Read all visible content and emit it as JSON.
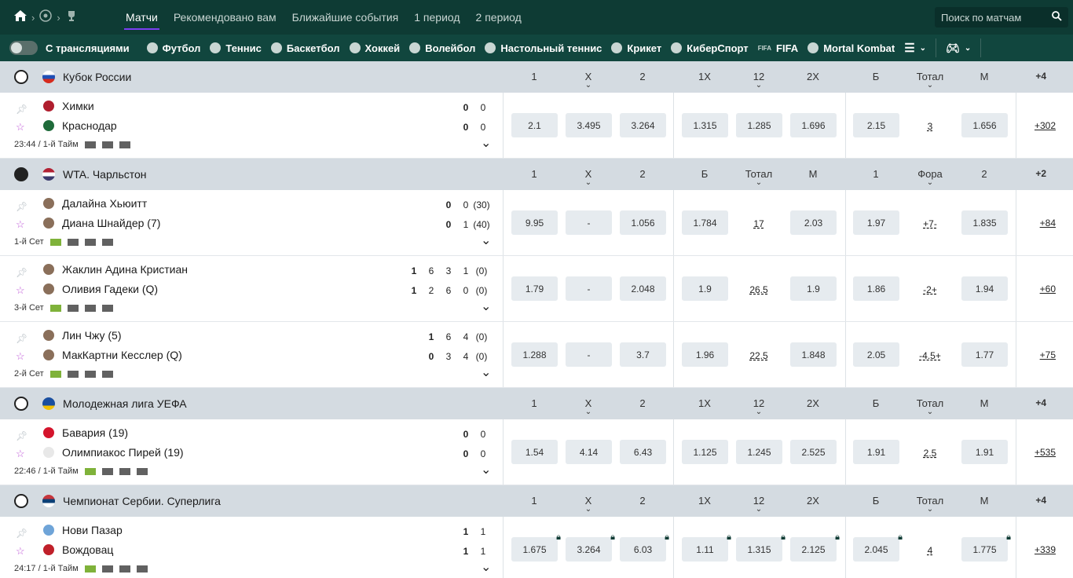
{
  "topbar": {
    "tabs": [
      "Матчи",
      "Рекомендовано вам",
      "Ближайшие события",
      "1 период",
      "2 период"
    ],
    "search_placeholder": "Поиск по матчам"
  },
  "sportbar": {
    "stream_label": "С трансляциями",
    "sports": [
      "Футбол",
      "Теннис",
      "Баскетбол",
      "Хоккей",
      "Волейбол",
      "Настольный теннис",
      "Крикет",
      "КиберСпорт",
      "FIFA",
      "Mortal Kombat"
    ]
  },
  "sections": [
    {
      "league": "Кубок России",
      "headers": [
        "1",
        "X",
        "2",
        "1X",
        "12",
        "2X",
        "Б",
        "Тотал",
        "М"
      ],
      "more": "+4",
      "matches": [
        {
          "team1": "Химки",
          "team2": "Краснодар",
          "meta": "23:44 / 1-й Тайм",
          "s1": [
            "0",
            "0"
          ],
          "s2": [
            "0",
            "0"
          ],
          "odds": [
            "2.1",
            "3.495",
            "3.264",
            "1.315",
            "1.285",
            "1.696",
            "2.15",
            "3",
            "1.656"
          ],
          "more": "+302"
        }
      ]
    },
    {
      "league": "WTA. Чарльстон",
      "headers": [
        "1",
        "X",
        "2",
        "Б",
        "Тотал",
        "М",
        "1",
        "Фора",
        "2"
      ],
      "more": "+2",
      "matches": [
        {
          "team1": "Далайна Хьюитт",
          "team2": "Диана Шнайдер (7)",
          "meta": "1-й Сет",
          "s1": [
            "0",
            "0",
            "(30)"
          ],
          "s2": [
            "0",
            "1",
            "(40)"
          ],
          "odds": [
            "9.95",
            "-",
            "1.056",
            "1.784",
            "17",
            "2.03",
            "1.97",
            "+7-",
            "1.835"
          ],
          "more": "+84"
        },
        {
          "team1": "Жаклин Адина Кристиан",
          "team2": "Оливия Гадеки (Q)",
          "meta": "3-й Сет",
          "s1": [
            "1",
            "6",
            "3",
            "1",
            "(0)"
          ],
          "s2": [
            "1",
            "2",
            "6",
            "0",
            "(0)"
          ],
          "odds": [
            "1.79",
            "-",
            "2.048",
            "1.9",
            "26.5",
            "1.9",
            "1.86",
            "-2+",
            "1.94"
          ],
          "more": "+60"
        },
        {
          "team1": "Лин Чжу (5)",
          "team2": "МакКартни Кесслер (Q)",
          "meta": "2-й Сет",
          "s1": [
            "1",
            "6",
            "4",
            "(0)"
          ],
          "s2": [
            "0",
            "3",
            "4",
            "(0)"
          ],
          "odds": [
            "1.288",
            "-",
            "3.7",
            "1.96",
            "22.5",
            "1.848",
            "2.05",
            "-4.5+",
            "1.77"
          ],
          "more": "+75"
        }
      ]
    },
    {
      "league": "Молодежная лига УЕФА",
      "headers": [
        "1",
        "X",
        "2",
        "1X",
        "12",
        "2X",
        "Б",
        "Тотал",
        "М"
      ],
      "more": "+4",
      "matches": [
        {
          "team1": "Бавария (19)",
          "team2": "Олимпиакос Пирей (19)",
          "meta": "22:46 / 1-й Тайм",
          "s1": [
            "0",
            "0"
          ],
          "s2": [
            "0",
            "0"
          ],
          "odds": [
            "1.54",
            "4.14",
            "6.43",
            "1.125",
            "1.245",
            "2.525",
            "1.91",
            "2.5",
            "1.91"
          ],
          "more": "+535"
        }
      ]
    },
    {
      "league": "Чемпионат Сербии. Суперлига",
      "headers": [
        "1",
        "X",
        "2",
        "1X",
        "12",
        "2X",
        "Б",
        "Тотал",
        "М"
      ],
      "more": "+4",
      "matches": [
        {
          "team1": "Нови Пазар",
          "team2": "Вождовац",
          "meta": "24:17 / 1-й Тайм",
          "s1": [
            "1",
            "1"
          ],
          "s2": [
            "1",
            "1"
          ],
          "odds": [
            "1.675",
            "3.264",
            "6.03",
            "1.11",
            "1.315",
            "2.125",
            "2.045",
            "4",
            "1.775"
          ],
          "more": "+339"
        }
      ]
    }
  ]
}
